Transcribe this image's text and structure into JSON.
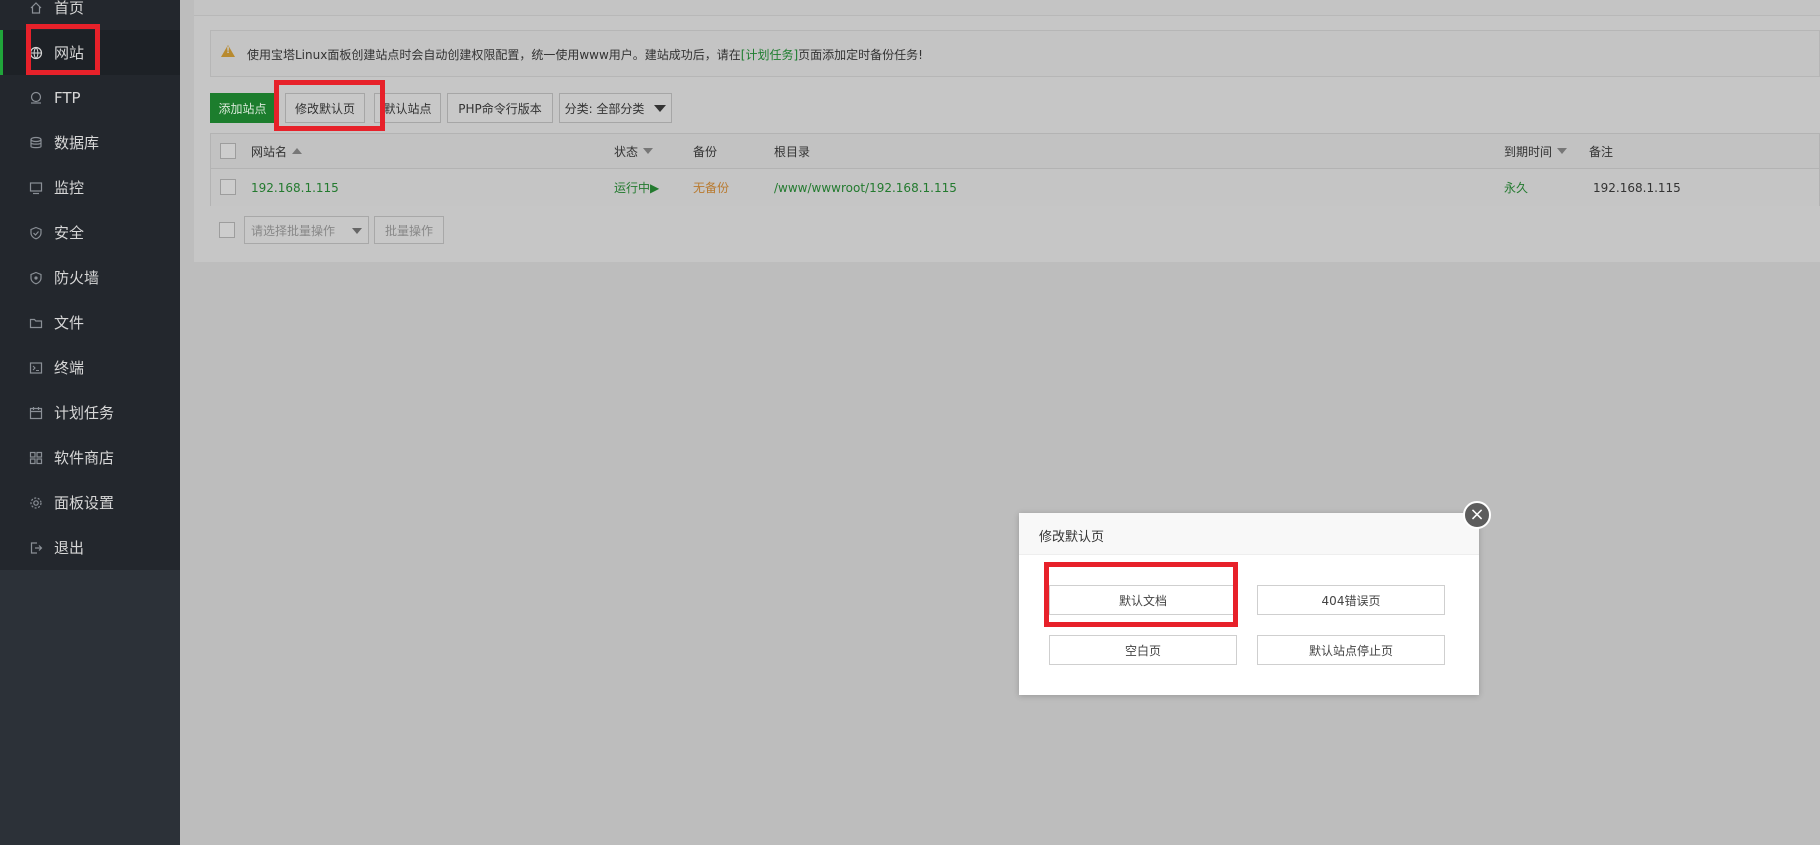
{
  "sidebar": {
    "items": [
      {
        "label": "首页",
        "icon": "home-icon"
      },
      {
        "label": "网站",
        "icon": "globe-icon"
      },
      {
        "label": "FTP",
        "icon": "ftp-icon"
      },
      {
        "label": "数据库",
        "icon": "database-icon"
      },
      {
        "label": "监控",
        "icon": "monitor-icon"
      },
      {
        "label": "安全",
        "icon": "shield-icon"
      },
      {
        "label": "防火墙",
        "icon": "firewall-icon"
      },
      {
        "label": "文件",
        "icon": "folder-icon"
      },
      {
        "label": "终端",
        "icon": "terminal-icon"
      },
      {
        "label": "计划任务",
        "icon": "calendar-icon"
      },
      {
        "label": "软件商店",
        "icon": "apps-icon"
      },
      {
        "label": "面板设置",
        "icon": "gear-icon"
      },
      {
        "label": "退出",
        "icon": "logout-icon"
      }
    ],
    "active_index": 1
  },
  "notice": {
    "text_before": "使用宝塔Linux面板创建站点时会自动创建权限配置，统一使用www用户。建站成功后，请在",
    "link": "[计划任务]",
    "text_after": "页面添加定时备份任务!"
  },
  "toolbar": {
    "add_site": "添加站点",
    "modify_default_page": "修改默认页",
    "default_site": "默认站点",
    "php_version": "PHP命令行版本",
    "category": "分类: 全部分类"
  },
  "table": {
    "headers": {
      "name": "网站名",
      "status": "状态",
      "backup": "备份",
      "root": "根目录",
      "expire": "到期时间",
      "remark": "备注"
    },
    "rows": [
      {
        "name": "192.168.1.115",
        "status": "运行中▶",
        "backup": "无备份",
        "root": "/www/wwwroot/192.168.1.115",
        "expire": "永久",
        "remark": "192.168.1.115"
      }
    ]
  },
  "batch": {
    "select_placeholder": "请选择批量操作",
    "button": "批量操作"
  },
  "modal": {
    "title": "修改默认页",
    "close": "×",
    "buttons": [
      "默认文档",
      "404错误页",
      "空白页",
      "默认站点停止页"
    ]
  },
  "colors": {
    "accent_green": "#20a53a",
    "highlight_red": "#e7212a"
  }
}
